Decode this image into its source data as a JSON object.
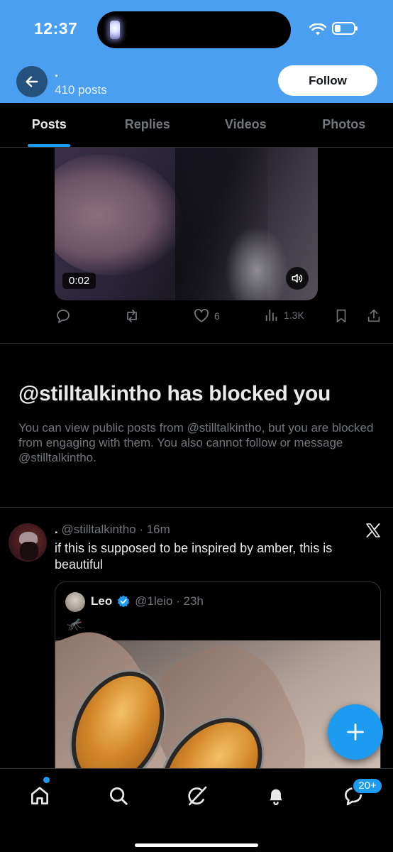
{
  "status_bar": {
    "time": "12:37"
  },
  "header": {
    "name": ".",
    "post_count": "410 posts",
    "follow_label": "Follow"
  },
  "tabs": [
    {
      "label": "Posts",
      "active": true
    },
    {
      "label": "Replies",
      "active": false
    },
    {
      "label": "Videos",
      "active": false
    },
    {
      "label": "Photos",
      "active": false
    }
  ],
  "video_post": {
    "duration": "0:02",
    "likes": "6",
    "views": "1.3K"
  },
  "blocked": {
    "title": "@stilltalkintho has blocked you",
    "message": "You can view public posts from @stilltalkintho, but you are blocked from engaging with them. You also cannot follow or message @stilltalkintho."
  },
  "post": {
    "name": ".",
    "handle_time": "@stilltalkintho · 16m",
    "text": "if this is supposed to be inspired by amber, this is beautiful",
    "quote": {
      "name": "Leo",
      "handle_time": "@1leio · 23h",
      "emoji": "🦟"
    }
  },
  "bottom_nav": {
    "messages_badge": "20+"
  },
  "colors": {
    "accent": "#1d9bf0",
    "header_bg": "#4a9ff0",
    "background": "#000000",
    "muted_text": "#71767b"
  }
}
